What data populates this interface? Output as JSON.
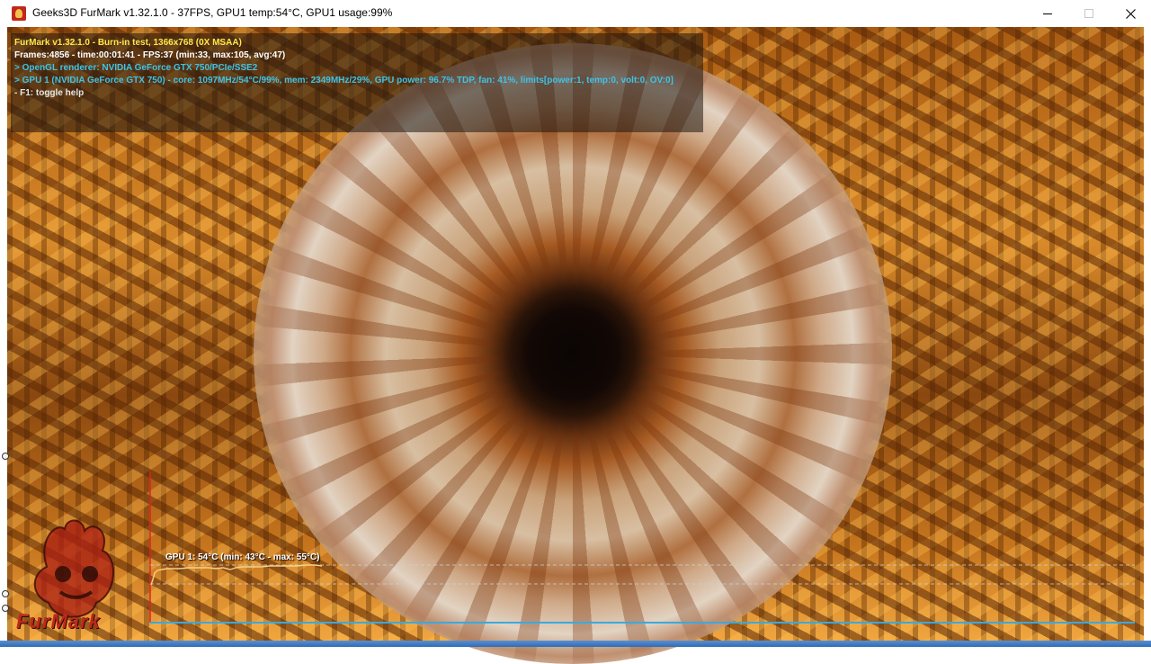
{
  "window": {
    "title": "Geeks3D FurMark v1.32.1.0 - 37FPS, GPU1 temp:54°C, GPU1 usage:99%",
    "icon": "furmark-app-icon",
    "controls": [
      "minimize-icon",
      "maximize-icon",
      "close-icon"
    ]
  },
  "overlay": {
    "line1": "FurMark v1.32.1.0 - Burn-in test, 1366x768 (0X MSAA)",
    "line2": "Frames:4856 - time:00:01:41 - FPS:37 (min:33, max:105, avg:47)",
    "line3": "> OpenGL renderer: NVIDIA GeForce GTX 750/PCIe/SSE2",
    "line4": "> GPU 1 (NVIDIA GeForce GTX 750) - core: 1097MHz/54°C/99%, mem: 2349MHz/29%, GPU power: 96.7% TDP, fan: 41%, limits[power:1, temp:0, volt:0, OV:0]",
    "line5": "- F1: toggle help"
  },
  "logo": {
    "text": "FurMark"
  },
  "graph": {
    "label": "GPU 1: 54°C (min: 43°C - max: 55°C)",
    "current_temp_c": 54,
    "min_temp_c": 43,
    "max_temp_c": 55
  },
  "colors": {
    "overlay_title": "#ffe84a",
    "overlay_info": "#3fc3e8",
    "graph_axis_y": "#e02020",
    "graph_axis_x": "#3aa9e0",
    "graph_line": "#f2d28a"
  }
}
